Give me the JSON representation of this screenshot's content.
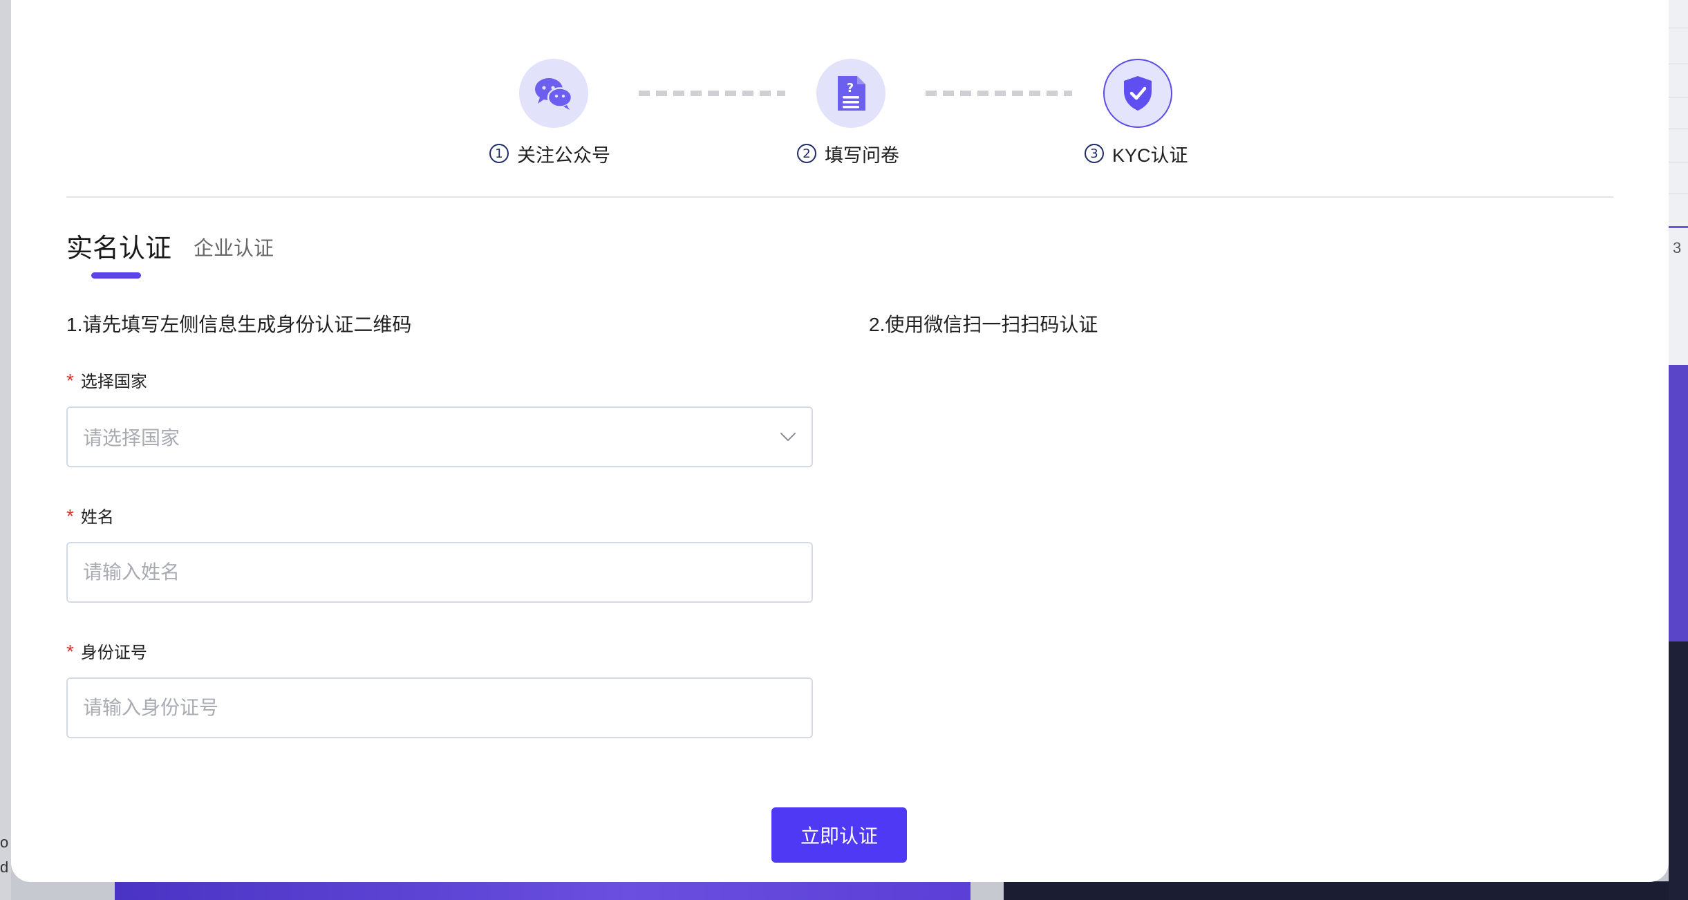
{
  "steps": [
    {
      "num": "1",
      "label": "关注公众号",
      "icon": "wechat-icon"
    },
    {
      "num": "2",
      "label": "填写问卷",
      "icon": "questionnaire-icon"
    },
    {
      "num": "3",
      "label": "KYC认证",
      "icon": "shield-check-icon"
    }
  ],
  "active_step": 3,
  "tabs": {
    "active": "实名认证",
    "inactive": "企业认证"
  },
  "left_section_title": "1.请先填写左侧信息生成身份认证二维码",
  "right_section_title": "2.使用微信扫一扫扫码认证",
  "form": {
    "required_mark": "*",
    "country": {
      "label": "选择国家",
      "placeholder": "请选择国家"
    },
    "name": {
      "label": "姓名",
      "placeholder": "请输入姓名"
    },
    "id_number": {
      "label": "身份证号",
      "placeholder": "请输入身份证号"
    }
  },
  "submit_label": "立即认证",
  "background": {
    "right_number": "3",
    "left_text_1": "o",
    "left_text_2": "d"
  },
  "colors": {
    "accent": "#5039f5",
    "icon_purple": "#6c5ff0",
    "step_bg": "#e2e3fb",
    "required_red": "#e5322d"
  }
}
